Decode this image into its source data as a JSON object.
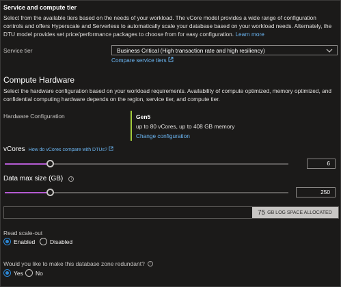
{
  "section_title": "Service and compute tier",
  "intro_text": "Select from the available tiers based on the needs of your workload. The vCore model provides a wide range of configuration controls and offers Hyperscale and Serverless to automatically scale your database based on your workload needs. Alternately, the DTU model provides set price/performance packages to choose from for easy configuration.",
  "intro_link": "Learn more",
  "service_tier": {
    "label": "Service tier",
    "value": "Business Critical (High transaction rate and high resiliency)",
    "compare_link": "Compare service tiers"
  },
  "compute_hardware": {
    "title": "Compute Hardware",
    "description": "Select the hardware configuration based on your workload requirements. Availability of compute optimized, memory optimized, and confidential computing hardware depends on the region, service tier, and compute tier.",
    "label": "Hardware Configuration",
    "gen": "Gen5",
    "gen_desc": "up to 80 vCores, up to 408 GB memory",
    "change_link": "Change configuration"
  },
  "vcores": {
    "label": "vCores",
    "link": "How do vCores compare with DTUs?",
    "value": "6",
    "fraction": 0.16
  },
  "data_max_size": {
    "label": "Data max size (GB)",
    "value": "250",
    "fraction": 0.16
  },
  "storage": {
    "amount": "75",
    "unit_label": "GB LOG SPACE ALLOCATED"
  },
  "read_scale_out": {
    "label": "Read scale-out",
    "options": [
      "Enabled",
      "Disabled"
    ],
    "selected": "Enabled"
  },
  "zone_redundant": {
    "label": "Would you like to make this database zone redundant?",
    "options": [
      "Yes",
      "No"
    ],
    "selected": "Yes"
  },
  "colors": {
    "accent": "#2b88d8",
    "slider": "#b45bd3",
    "hardware_marker": "#a4cc3c",
    "link": "#6cb8f6"
  }
}
